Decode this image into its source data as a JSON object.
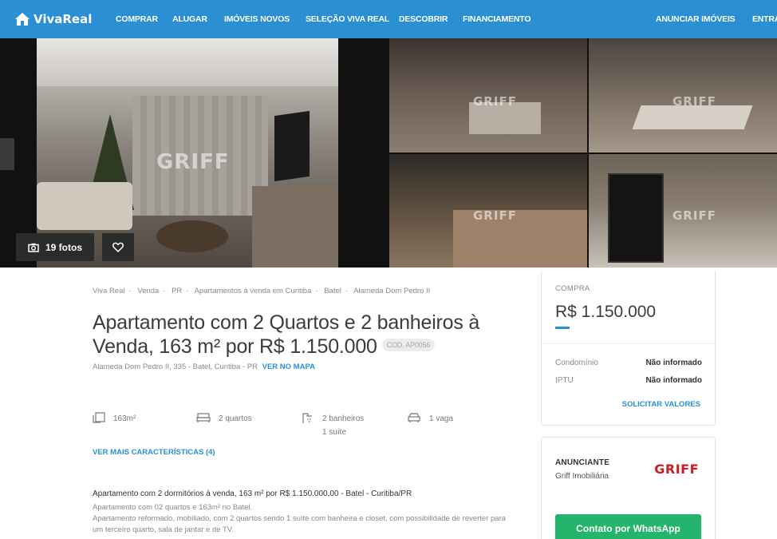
{
  "nav": {
    "brand": "VivaReal",
    "links": [
      "COMPRAR",
      "ALUGAR",
      "IMÓVEIS NOVOS",
      "SELEÇÃO VIVA REAL",
      "DESCOBRIR",
      "FINANCIAMENTO"
    ],
    "right_links": [
      "ANUNCIAR IMÓVEIS",
      "ENTRAR"
    ]
  },
  "gallery": {
    "watermark": "GRIFF",
    "photos_count_label": "19 fotos"
  },
  "breadcrumb": [
    "Viva Real",
    "Venda",
    "PR",
    "Apartamentos à venda em Curitiba",
    "Batel",
    "Alameda Dom Pedro II"
  ],
  "listing": {
    "title": "Apartamento com 2 Quartos e 2 banheiros à Venda, 163 m² por R$ 1.150.000",
    "code": "COD. AP0056",
    "address": "Alameda Dom Pedro II, 335 - Batel, Curitiba - PR",
    "map_link": "VER NO MAPA",
    "features": {
      "area": "163m²",
      "rooms": "2 quartos",
      "bathrooms": "2 banheiros",
      "suites": "1 suíte",
      "parking": "1 vaga"
    },
    "more_features": "VER MAIS CARACTERÍSTICAS (4)",
    "description_title": "Apartamento com 2 dormitórios à venda, 163 m² por R$ 1.150.000,00 - Batel - Curitiba/PR",
    "description_lines": [
      "Apartamento com 02 quartos e 163m² no Batel.",
      "Apartamento reformado, mobiliado, com 2 quartos sendo 1 suíte com banheira e closet, com possibilidade de reverter para um terceiro quarto, sala de jantar e de TV."
    ]
  },
  "price_card": {
    "label": "COMPRA",
    "price": "R$ 1.150.000",
    "condo_label": "Condomínio",
    "condo_value": "Não informado",
    "iptu_label": "IPTU",
    "iptu_value": "Não informado",
    "request_link": "SOLICITAR VALORES"
  },
  "agent_card": {
    "label": "ANUNCIANTE",
    "name": "Griff Imobiliária",
    "brand": "GRIFF",
    "button": "Contato por WhatsApp"
  },
  "colors": {
    "brand_blue": "#2b8fd4",
    "whatsapp_green": "#25b46b",
    "griff_red": "#c81d25"
  }
}
